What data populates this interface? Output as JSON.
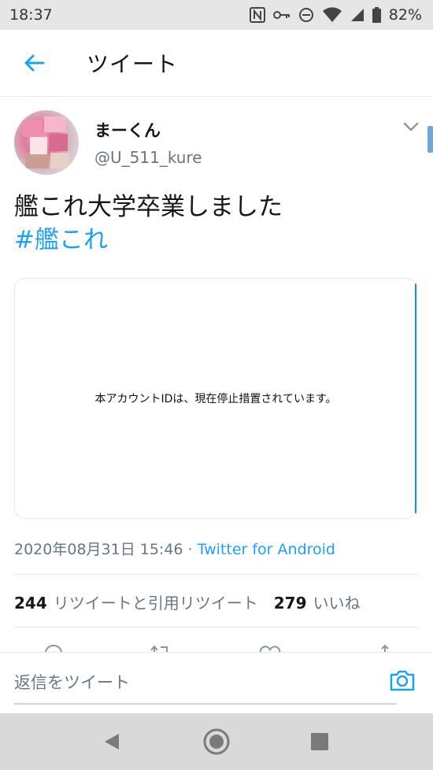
{
  "status_bar": {
    "time": "18:37",
    "battery": "82%"
  },
  "header": {
    "title": "ツイート"
  },
  "tweet": {
    "display_name": "まーくん",
    "handle": "@U_511_kure",
    "text": "艦これ大学卒業しました",
    "hashtag": "#艦これ",
    "card_message": "本アカウントIDは、現在停止措置されています。",
    "date": "2020年08月31日 15:46",
    "separator": " · ",
    "source": "Twitter for Android",
    "retweet_count": "244",
    "retweet_label": "リツイートと引用リツイート",
    "like_count": "279",
    "like_label": "いいね"
  },
  "reply": {
    "placeholder": "返信をツイート"
  },
  "colors": {
    "accent": "#1da1f2",
    "muted": "#657786"
  },
  "icons": [
    "back-arrow-icon",
    "chevron-down-icon",
    "reply-icon",
    "retweet-icon",
    "like-icon",
    "share-icon",
    "camera-icon",
    "nav-back-icon",
    "nav-home-icon",
    "nav-recents-icon"
  ]
}
